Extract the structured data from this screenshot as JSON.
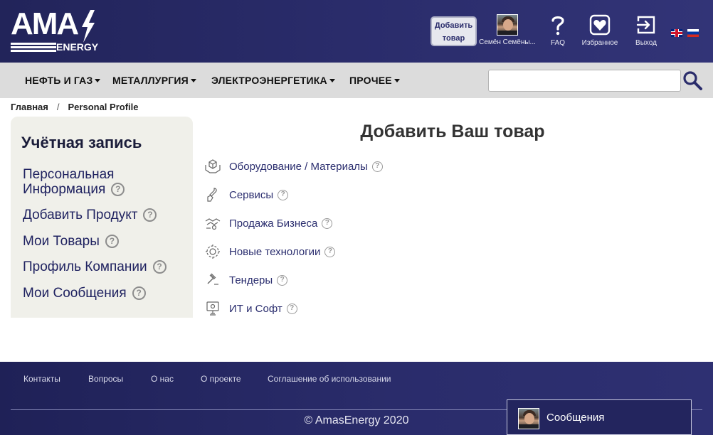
{
  "header": {
    "logo_main": "AMAS",
    "logo_sub": "ENERGY",
    "add_product_line1": "Добавить",
    "add_product_line2": "товар",
    "user_name": "Семён Семёны...",
    "faq_label": "FAQ",
    "favorites_label": "Избранное",
    "logout_label": "Выход",
    "languages": [
      "en",
      "ru"
    ]
  },
  "nav": {
    "items": [
      {
        "label": "НЕФТЬ И ГАЗ"
      },
      {
        "label": "МЕТАЛЛУРГИЯ"
      },
      {
        "label": "ЭЛЕКТРОЭНЕРГЕТИКА"
      },
      {
        "label": "ПРОЧЕЕ"
      }
    ],
    "search_value": ""
  },
  "breadcrumb": {
    "home": "Главная",
    "separator": "/",
    "current": "Personal Profile"
  },
  "sidebar": {
    "title": "Учётная запись",
    "items": [
      {
        "label_line1": "Персональная",
        "label_line2": "Информация"
      },
      {
        "label": "Добавить Продукт"
      },
      {
        "label": "Мои Товары"
      },
      {
        "label": "Профиль Компании"
      },
      {
        "label": "Мои Сообщения"
      }
    ],
    "help_glyph": "?"
  },
  "main": {
    "title": "Добавить Ваш товар",
    "categories": [
      {
        "label": "Оборудование / Материалы",
        "icon": "box-hands-icon"
      },
      {
        "label": "Сервисы",
        "icon": "wrench-hand-icon"
      },
      {
        "label": "Продажа Бизнеса",
        "icon": "handshake-icon"
      },
      {
        "label": "Новые технологии",
        "icon": "gear-tech-icon"
      },
      {
        "label": "Тендеры",
        "icon": "gavel-icon"
      },
      {
        "label": "ИТ и Софт",
        "icon": "monitor-gear-icon"
      }
    ]
  },
  "footer": {
    "links": [
      {
        "label": "Контакты"
      },
      {
        "label": "Вопросы"
      },
      {
        "label": "О нас"
      },
      {
        "label": "О проекте"
      },
      {
        "label": "Соглашение об использовании"
      }
    ],
    "copyright": "© AmasEnergy 2020"
  },
  "messages_widget": {
    "label": "Сообщения"
  },
  "colors": {
    "header_bg": "#2a2c6b",
    "nav_bg": "#dcdcdc",
    "sidebar_bg": "#f0f0ea",
    "link": "#2a2d6e"
  }
}
